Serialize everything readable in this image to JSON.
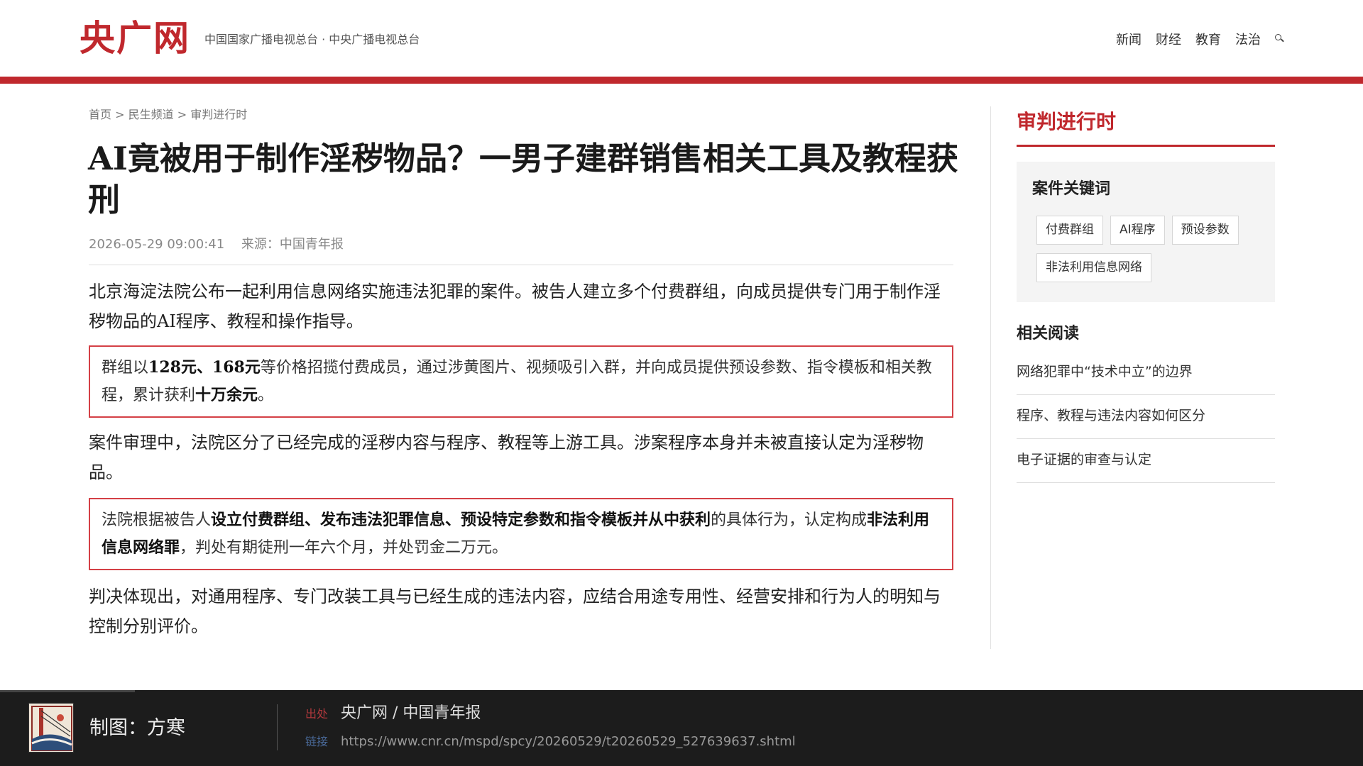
{
  "header": {
    "logo": "央广网",
    "tagline": "中国国家广播电视总台 · 中央广播电视总台",
    "nav": [
      "新闻",
      "财经",
      "教育",
      "法治"
    ]
  },
  "breadcrumb": {
    "home": "首页",
    "channel": "民生频道",
    "section": "审判进行时",
    "sep": ">"
  },
  "article": {
    "title": "AI竟被用于制作淫秽物品？一男子建群销售相关工具及教程获刑",
    "date": "2026-05-29 09:00:41",
    "source": "来源：中国青年报",
    "p1": "北京海淀法院公布一起利用信息网络实施违法犯罪的案件。被告人建立多个付费群组，向成员提供专门用于制作淫秽物品的AI程序、教程和操作指导。",
    "box1": {
      "t1": "群组以",
      "b1": "128元、168元",
      "t2": "等价格招揽付费成员，通过涉黄图片、视频吸引入群，并向成员提供预设参数、指令模板和相关教程，累计获利",
      "b2": "十万余元",
      "t3": "。"
    },
    "p2": "案件审理中，法院区分了已经完成的淫秽内容与程序、教程等上游工具。涉案程序本身并未被直接认定为淫秽物品。",
    "box2": {
      "t1": "法院根据被告人",
      "b1": "设立付费群组、发布违法犯罪信息、预设特定参数和指令模板并从中获利",
      "t2": "的具体行为，认定构成",
      "b2": "非法利用信息网络罪",
      "t3": "，判处有期徒刑一年六个月，并处罚金二万元。"
    },
    "p3": "判决体现出，对通用程序、专门改装工具与已经生成的违法内容，应结合用途专用性、经营安排和行为人的明知与控制分别评价。"
  },
  "sidebar": {
    "title": "审判进行时",
    "keywords_heading": "案件关键词",
    "tags": [
      "付费群组",
      "AI程序",
      "预设参数",
      "非法利用信息网络"
    ],
    "related_heading": "相关阅读",
    "related": [
      "网络犯罪中“技术中立”的边界",
      "程序、教程与违法内容如何区分",
      "电子证据的审查与认定"
    ]
  },
  "footer": {
    "credit": "制图：方寒",
    "source_label": "出处",
    "source_value": "央广网 / 中国青年报",
    "link_label": "链接",
    "link_value": "https://www.cnr.cn/mspd/spcy/20260529/t20260529_527639637.shtml"
  },
  "colors": {
    "brand_red": "#c0282d",
    "box_border": "#d44046",
    "footer_bg": "#1c1c1c"
  }
}
